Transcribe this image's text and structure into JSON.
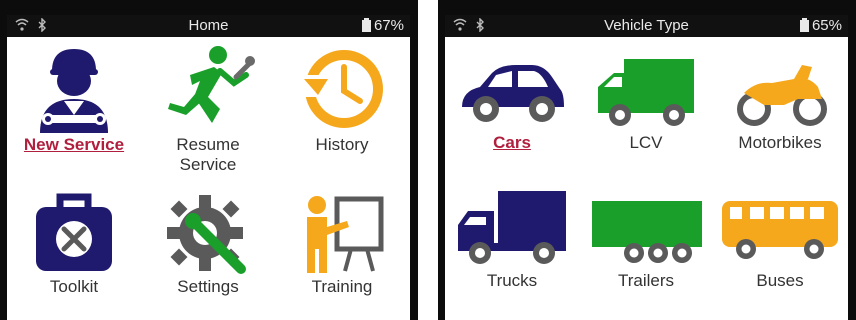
{
  "home_screen": {
    "title": "Home",
    "battery": "67%",
    "tiles": [
      {
        "label": "New Service",
        "icon": "mechanic-icon",
        "selected": true
      },
      {
        "label": "Resume",
        "label2": "Service",
        "icon": "running-man-wrench-icon"
      },
      {
        "label": "History",
        "icon": "history-clock-icon"
      },
      {
        "label": "Toolkit",
        "icon": "toolbox-icon"
      },
      {
        "label": "Settings",
        "icon": "gear-wrench-icon"
      },
      {
        "label": "Training",
        "icon": "presenter-board-icon"
      }
    ]
  },
  "vehicle_screen": {
    "title": "Vehicle Type",
    "battery": "65%",
    "tiles": [
      {
        "label": "Cars",
        "icon": "car-icon",
        "selected": true
      },
      {
        "label": "LCV",
        "icon": "van-icon"
      },
      {
        "label": "Motorbikes",
        "icon": "motorbike-icon"
      },
      {
        "label": "Trucks",
        "icon": "truck-icon"
      },
      {
        "label": "Trailers",
        "icon": "trailer-icon"
      },
      {
        "label": "Buses",
        "icon": "bus-icon"
      }
    ]
  },
  "colors": {
    "navy": "#1f1a6e",
    "green": "#1aa02a",
    "orange": "#f6a81c",
    "gray": "#5a5a5a",
    "selected_text": "#b01f3e"
  }
}
